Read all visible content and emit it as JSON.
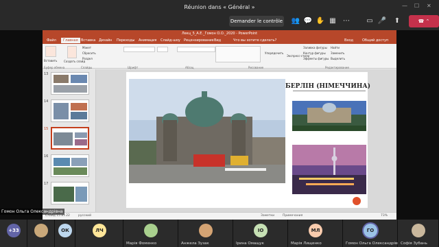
{
  "teams": {
    "meeting_title": "Réunion dans « Général »",
    "request_control": "Demander le contrôle",
    "leave_label": "⌃",
    "win_min": "—",
    "win_max": "☐",
    "win_close": "✕"
  },
  "ppt": {
    "window_title": "Лекц_5_А.Е._Гомон О.О._2020 - PowerPoint",
    "tabs": [
      "Файл",
      "Главная",
      "Вставка",
      "Дизайн",
      "Переходы",
      "Анимация",
      "Слайд-шоу",
      "Рецензирование",
      "Вид",
      "Что вы хотите сделать?"
    ],
    "account": "Вход",
    "share": "Общий доступ",
    "ribbon": {
      "paste": "Вставить",
      "layout": "Макет",
      "reset": "Сбросить",
      "section": "Раздел",
      "new_slide": "Создать слайд",
      "find": "Найти",
      "replace": "Заменить",
      "select": "Выделить",
      "arrange": "Упорядочить",
      "quick_styles": "Экспресс-стили",
      "fill": "Заливка фигуры",
      "outline": "Контур фигуры",
      "effects": "Эффекты фигуры",
      "groups": [
        "Буфер обмена",
        "Слайды",
        "Шрифт",
        "Абзац",
        "Рисование",
        "Редактирование"
      ]
    },
    "thumbnails": [
      "13",
      "14",
      "15",
      "16",
      "17"
    ],
    "slide": {
      "title": "БЕРЛІН (НІМЕЧЧИНА)"
    },
    "status": {
      "slide_of": "Слайд 15 из 22",
      "language": "русский",
      "notes": "Заметки",
      "comments": "Примечания",
      "zoom": "73%"
    }
  },
  "presenter_name": "Гомон Ольга Олександрівна",
  "participants": [
    {
      "initials": "+33",
      "name": "",
      "color": "#6264a7"
    },
    {
      "initials": "",
      "name": "",
      "color": "#c9a87a"
    },
    {
      "initials": "ОК",
      "name": "",
      "color": "#bdd7ee"
    },
    {
      "initials": "ЛЧ",
      "name": "",
      "color": "#ffe699"
    },
    {
      "initials": "",
      "name": "Марія Фоменко",
      "color": "#a9d08e"
    },
    {
      "initials": "",
      "name": "Анжела Зузак",
      "color": "#d4a373"
    },
    {
      "initials": "ІО",
      "name": "Ірина Омащук",
      "color": "#c6e0b4"
    },
    {
      "initials": "МЛ",
      "name": "Марія Лищенко",
      "color": "#f8cbad"
    },
    {
      "initials": "ГО",
      "name": "Гомон Ольга Олександрівна",
      "color": "#9bc2e6"
    },
    {
      "initials": "",
      "name": "Софія Зубань",
      "color": "#c9b79c"
    }
  ],
  "colors": {
    "ppt_accent": "#b7472a",
    "teams_bar": "#292929",
    "hangup": "#c4314b",
    "active_speaker_ring": "#6264a7"
  }
}
